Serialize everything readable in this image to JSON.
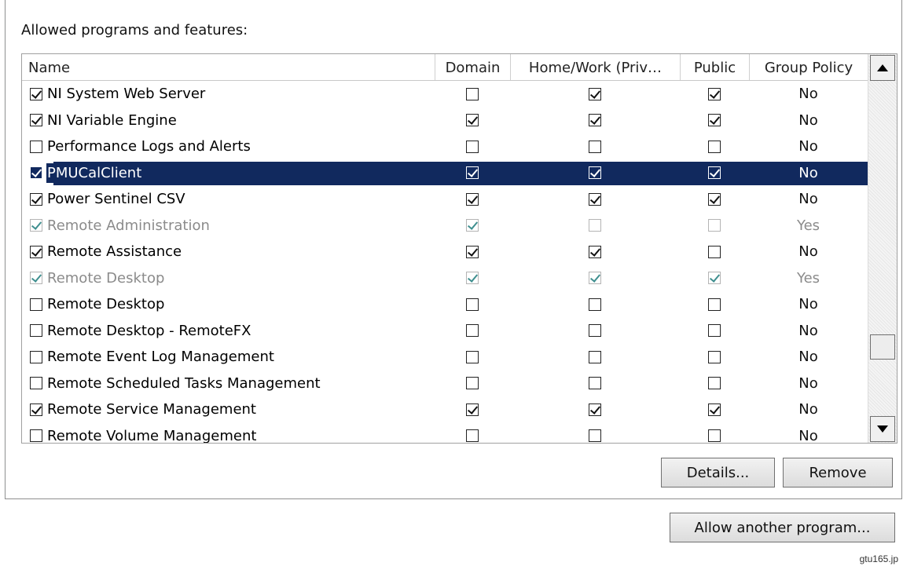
{
  "section_label": "Allowed programs and features:",
  "columns": {
    "name": "Name",
    "domain": "Domain",
    "home_work": "Home/Work (Priv…",
    "public": "Public",
    "group_policy": "Group Policy"
  },
  "rows": [
    {
      "name": "NI System Web Server",
      "enabled": true,
      "domain": false,
      "home_work": true,
      "public": true,
      "group_policy": "No",
      "disabled": false,
      "selected": false
    },
    {
      "name": "NI Variable Engine",
      "enabled": true,
      "domain": true,
      "home_work": true,
      "public": true,
      "group_policy": "No",
      "disabled": false,
      "selected": false
    },
    {
      "name": "Performance Logs and Alerts",
      "enabled": false,
      "domain": false,
      "home_work": false,
      "public": false,
      "group_policy": "No",
      "disabled": false,
      "selected": false
    },
    {
      "name": "PMUCalClient",
      "enabled": true,
      "domain": true,
      "home_work": true,
      "public": true,
      "group_policy": "No",
      "disabled": false,
      "selected": true
    },
    {
      "name": "Power Sentinel CSV",
      "enabled": true,
      "domain": true,
      "home_work": true,
      "public": true,
      "group_policy": "No",
      "disabled": false,
      "selected": false
    },
    {
      "name": "Remote Administration",
      "enabled": true,
      "domain": true,
      "home_work": false,
      "public": false,
      "group_policy": "Yes",
      "disabled": true,
      "selected": false
    },
    {
      "name": "Remote Assistance",
      "enabled": true,
      "domain": true,
      "home_work": true,
      "public": false,
      "group_policy": "No",
      "disabled": false,
      "selected": false
    },
    {
      "name": "Remote Desktop",
      "enabled": true,
      "domain": true,
      "home_work": true,
      "public": true,
      "group_policy": "Yes",
      "disabled": true,
      "selected": false
    },
    {
      "name": "Remote Desktop",
      "enabled": false,
      "domain": false,
      "home_work": false,
      "public": false,
      "group_policy": "No",
      "disabled": false,
      "selected": false
    },
    {
      "name": "Remote Desktop - RemoteFX",
      "enabled": false,
      "domain": false,
      "home_work": false,
      "public": false,
      "group_policy": "No",
      "disabled": false,
      "selected": false
    },
    {
      "name": "Remote Event Log Management",
      "enabled": false,
      "domain": false,
      "home_work": false,
      "public": false,
      "group_policy": "No",
      "disabled": false,
      "selected": false
    },
    {
      "name": "Remote Scheduled Tasks Management",
      "enabled": false,
      "domain": false,
      "home_work": false,
      "public": false,
      "group_policy": "No",
      "disabled": false,
      "selected": false
    },
    {
      "name": "Remote Service Management",
      "enabled": true,
      "domain": true,
      "home_work": true,
      "public": true,
      "group_policy": "No",
      "disabled": false,
      "selected": false
    },
    {
      "name": "Remote Volume Management",
      "enabled": false,
      "domain": false,
      "home_work": false,
      "public": false,
      "group_policy": "No",
      "disabled": false,
      "selected": false
    }
  ],
  "scrollbar": {
    "up_icon": "arrow-up-icon",
    "down_icon": "arrow-down-icon"
  },
  "buttons": {
    "details": "Details...",
    "remove": "Remove",
    "allow_another": "Allow another program..."
  },
  "watermark": "gtu165.jp",
  "colors": {
    "selection": "#11295e",
    "disabled_check": "#3f8f8f"
  }
}
